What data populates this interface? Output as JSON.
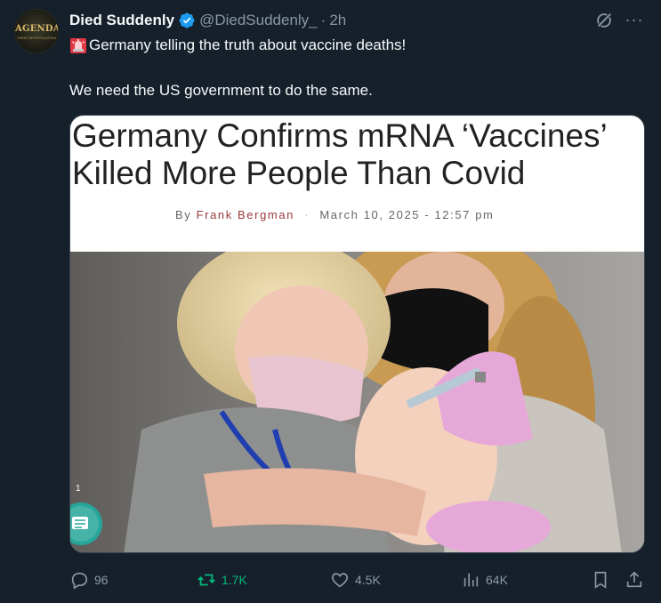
{
  "tweet": {
    "author_name": "Died Suddenly",
    "handle": "@DiedSuddenly_",
    "separator": "·",
    "time": "2h",
    "avatar_text": "AGENDA",
    "avatar_subtext": "THEIR DEPOPULATION",
    "line1": "Germany telling the truth about vaccine deaths!",
    "line2": "We need the US government to do the same."
  },
  "card": {
    "headline": "Germany Confirms mRNA ‘Vaccines’ Killed More People Than Covid",
    "byline_prefix": "By",
    "byline_author": "Frank Bergman",
    "byline_sep": "·",
    "byline_date": "March 10, 2025 - 12:57 pm",
    "overlay_count": "1"
  },
  "actions": {
    "replies": "96",
    "reposts": "1.7K",
    "likes": "4.5K",
    "views": "64K"
  },
  "colors": {
    "background": "#15202b",
    "verified": "#1d9bf0",
    "repost_active": "#00ba7c",
    "muted": "#8b98a5"
  }
}
